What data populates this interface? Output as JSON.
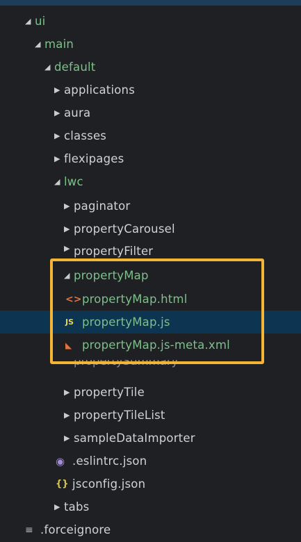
{
  "tree": {
    "ui": "ui",
    "main": "main",
    "default": "default",
    "applications": "applications",
    "aura": "aura",
    "classes": "classes",
    "flexipages": "flexipages",
    "lwc": "lwc",
    "paginator": "paginator",
    "propertyCarousel": "propertyCarousel",
    "propertyFilter": "propertyFilter",
    "propertyMap": "propertyMap",
    "propertyMapHtml": "propertyMap.html",
    "propertyMapJs": "propertyMap.js",
    "propertyMapMeta": "propertyMap.js-meta.xml",
    "propertySummary": "propertySummary",
    "propertyTile": "propertyTile",
    "propertyTileList": "propertyTileList",
    "sampleDataImporter": "sampleDataImporter",
    "eslintrc": ".eslintrc.json",
    "jsconfig": "jsconfig.json",
    "tabs": "tabs",
    "forceignore": ".forceignore"
  },
  "icons": {
    "html": "<>",
    "js": "JS",
    "json": "{}"
  },
  "colors": {
    "background": "#1e2024",
    "selected_row": "#0d3451",
    "highlight_border": "#f5b433",
    "folder_open_text": "#7ec08a",
    "folder_closed_text": "#d0d3d6"
  }
}
